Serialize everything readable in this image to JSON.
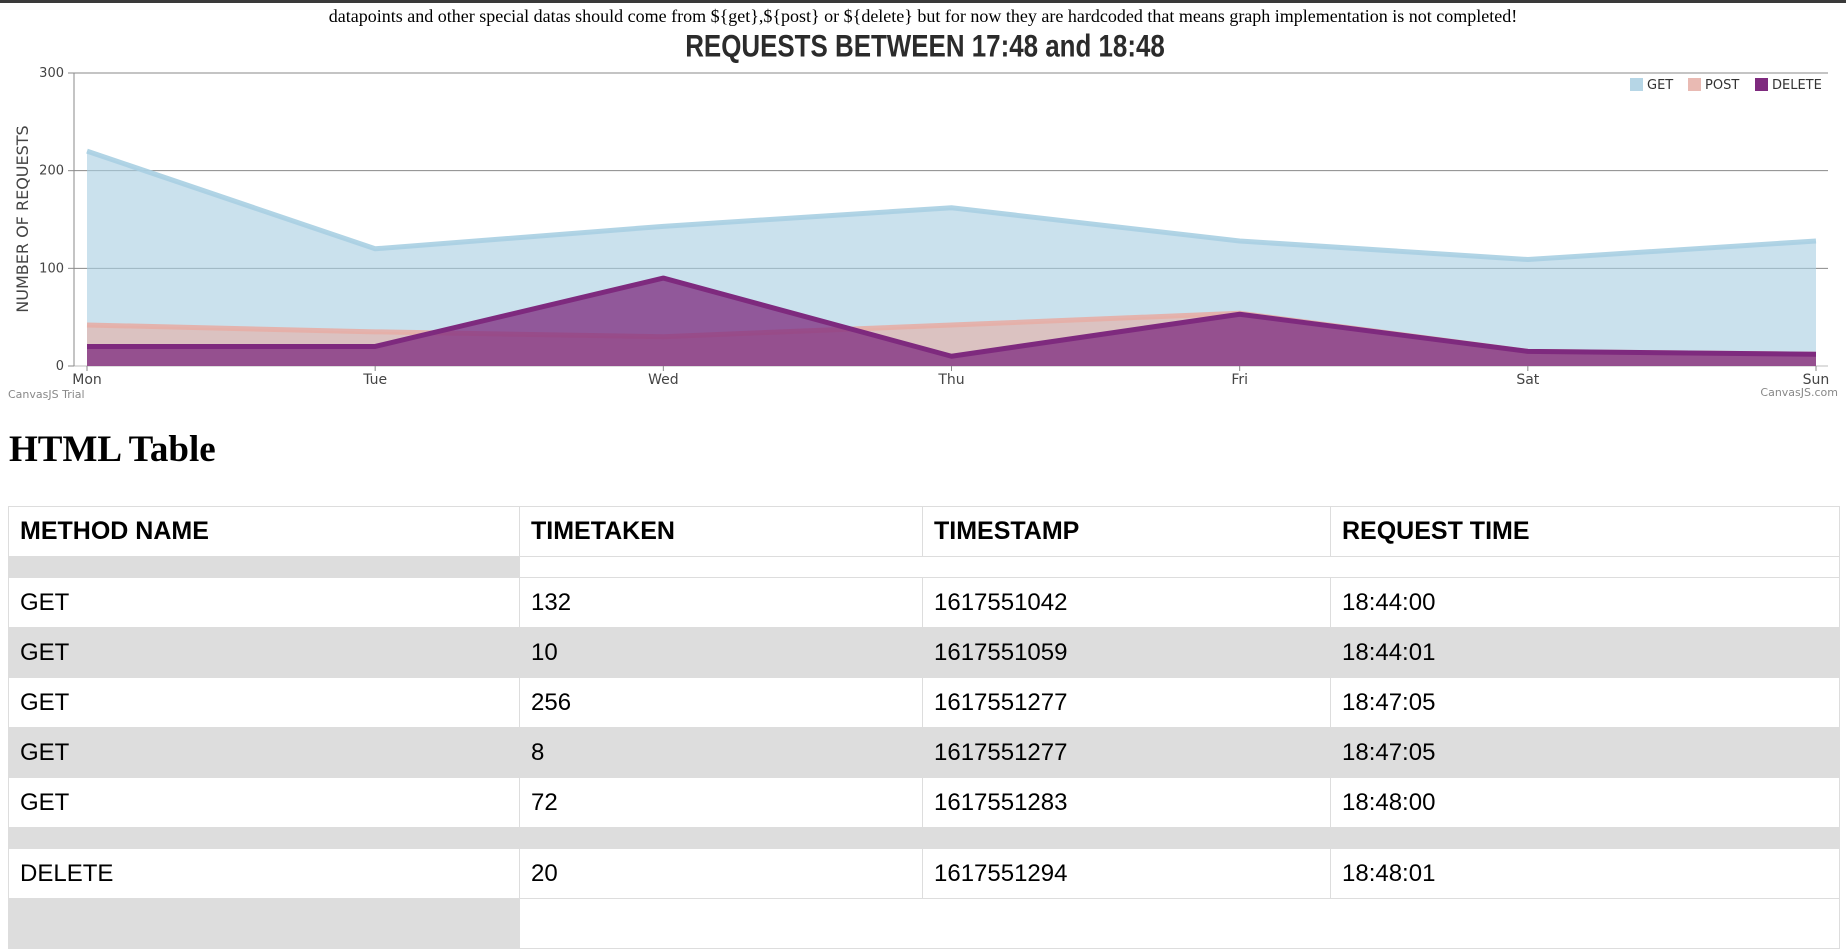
{
  "note": "datapoints and other special datas should come from ${get},${post} or ${delete} but for now they are hardcoded that means graph implementation is not completed!",
  "chart_data": {
    "type": "area",
    "title": "REQUESTS BETWEEN 17:48 and 18:48",
    "xlabel": "",
    "ylabel": "NUMBER OF REQUESTS",
    "categories": [
      "Mon",
      "Tue",
      "Wed",
      "Thu",
      "Fri",
      "Sat",
      "Sun"
    ],
    "ylim": [
      0,
      300
    ],
    "yticks": [
      "0",
      "100",
      "200",
      "300"
    ],
    "grid": true,
    "legend": "top-right",
    "series": [
      {
        "name": "GET",
        "color": "#a9cfe2",
        "values": [
          220,
          120,
          143,
          162,
          128,
          109,
          128
        ]
      },
      {
        "name": "POST",
        "color": "#e5aea6",
        "values": [
          42,
          35,
          30,
          42,
          54,
          15,
          12
        ]
      },
      {
        "name": "DELETE",
        "color": "#7e2a7e",
        "values": [
          20,
          20,
          90,
          10,
          53,
          15,
          12
        ]
      }
    ],
    "watermark_left": "CanvasJS Trial",
    "watermark_right": "CanvasJS.com"
  },
  "table_title": "HTML Table",
  "table": {
    "headers": [
      "METHOD NAME",
      "TIMETAKEN",
      "TIMESTAMP",
      "REQUEST TIME"
    ],
    "rows": [
      [
        "GET",
        "132",
        "1617551042",
        "18:44:00"
      ],
      [
        "GET",
        "10",
        "1617551059",
        "18:44:01"
      ],
      [
        "GET",
        "256",
        "1617551277",
        "18:47:05"
      ],
      [
        "GET",
        "8",
        "1617551277",
        "18:47:05"
      ],
      [
        "GET",
        "72",
        "1617551283",
        "18:48:00"
      ],
      [
        "DELETE",
        "20",
        "1617551294",
        "18:48:01"
      ]
    ]
  }
}
